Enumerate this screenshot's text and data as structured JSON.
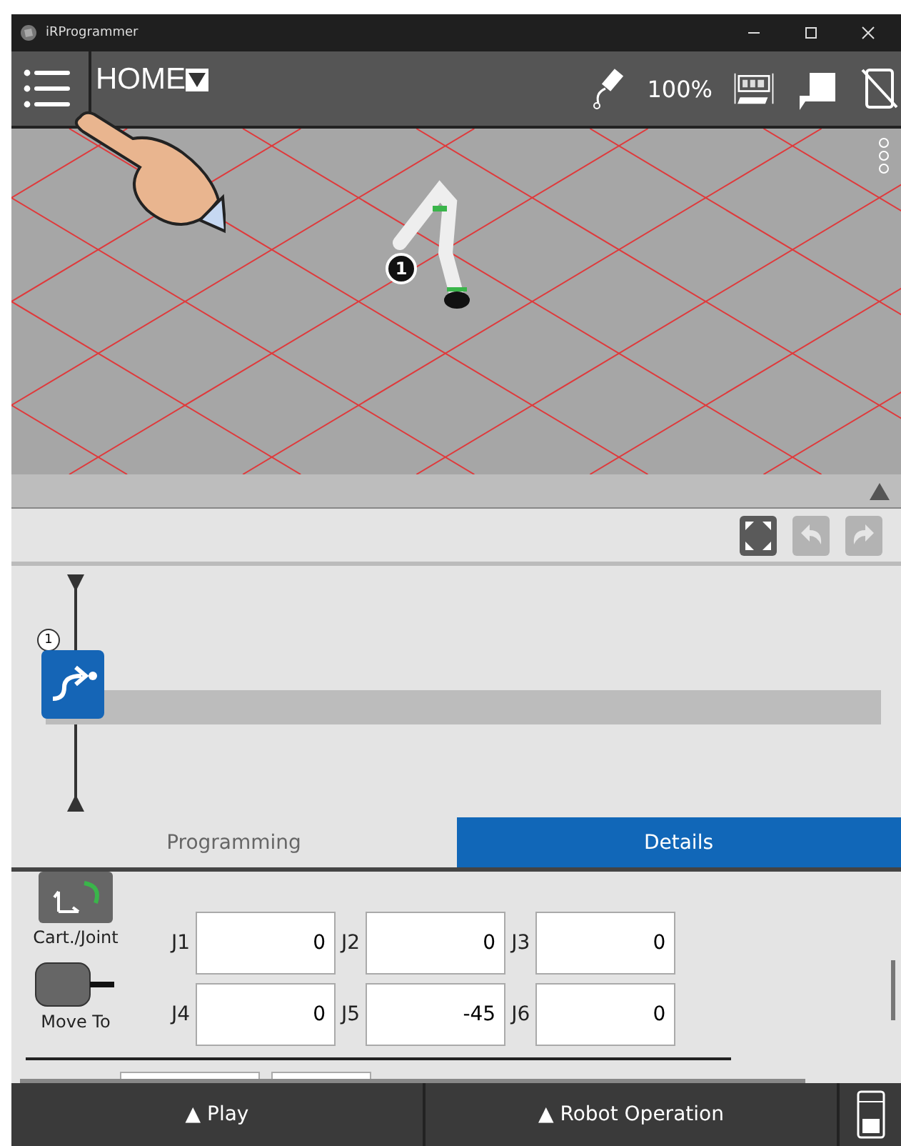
{
  "window": {
    "title": "iRProgrammer"
  },
  "header": {
    "menu": "HOME",
    "speed": "100%"
  },
  "viewport": {
    "marker": "1"
  },
  "timeline": {
    "nodes": [
      {
        "number": "1"
      }
    ]
  },
  "tabs": [
    {
      "label": "Programming",
      "selected": false
    },
    {
      "label": "Details",
      "selected": true
    }
  ],
  "details": {
    "cart_joint_label": "Cart./Joint",
    "move_to_label": "Move To",
    "joints": [
      {
        "label": "J1",
        "value": "0"
      },
      {
        "label": "J2",
        "value": "0"
      },
      {
        "label": "J3",
        "value": "0"
      },
      {
        "label": "J4",
        "value": "0"
      },
      {
        "label": "J5",
        "value": "-45"
      },
      {
        "label": "J6",
        "value": "0"
      }
    ]
  },
  "bottom_bar": {
    "buttons": [
      {
        "label": "▲ Play"
      },
      {
        "label": "▲ Robot Operation"
      }
    ]
  }
}
